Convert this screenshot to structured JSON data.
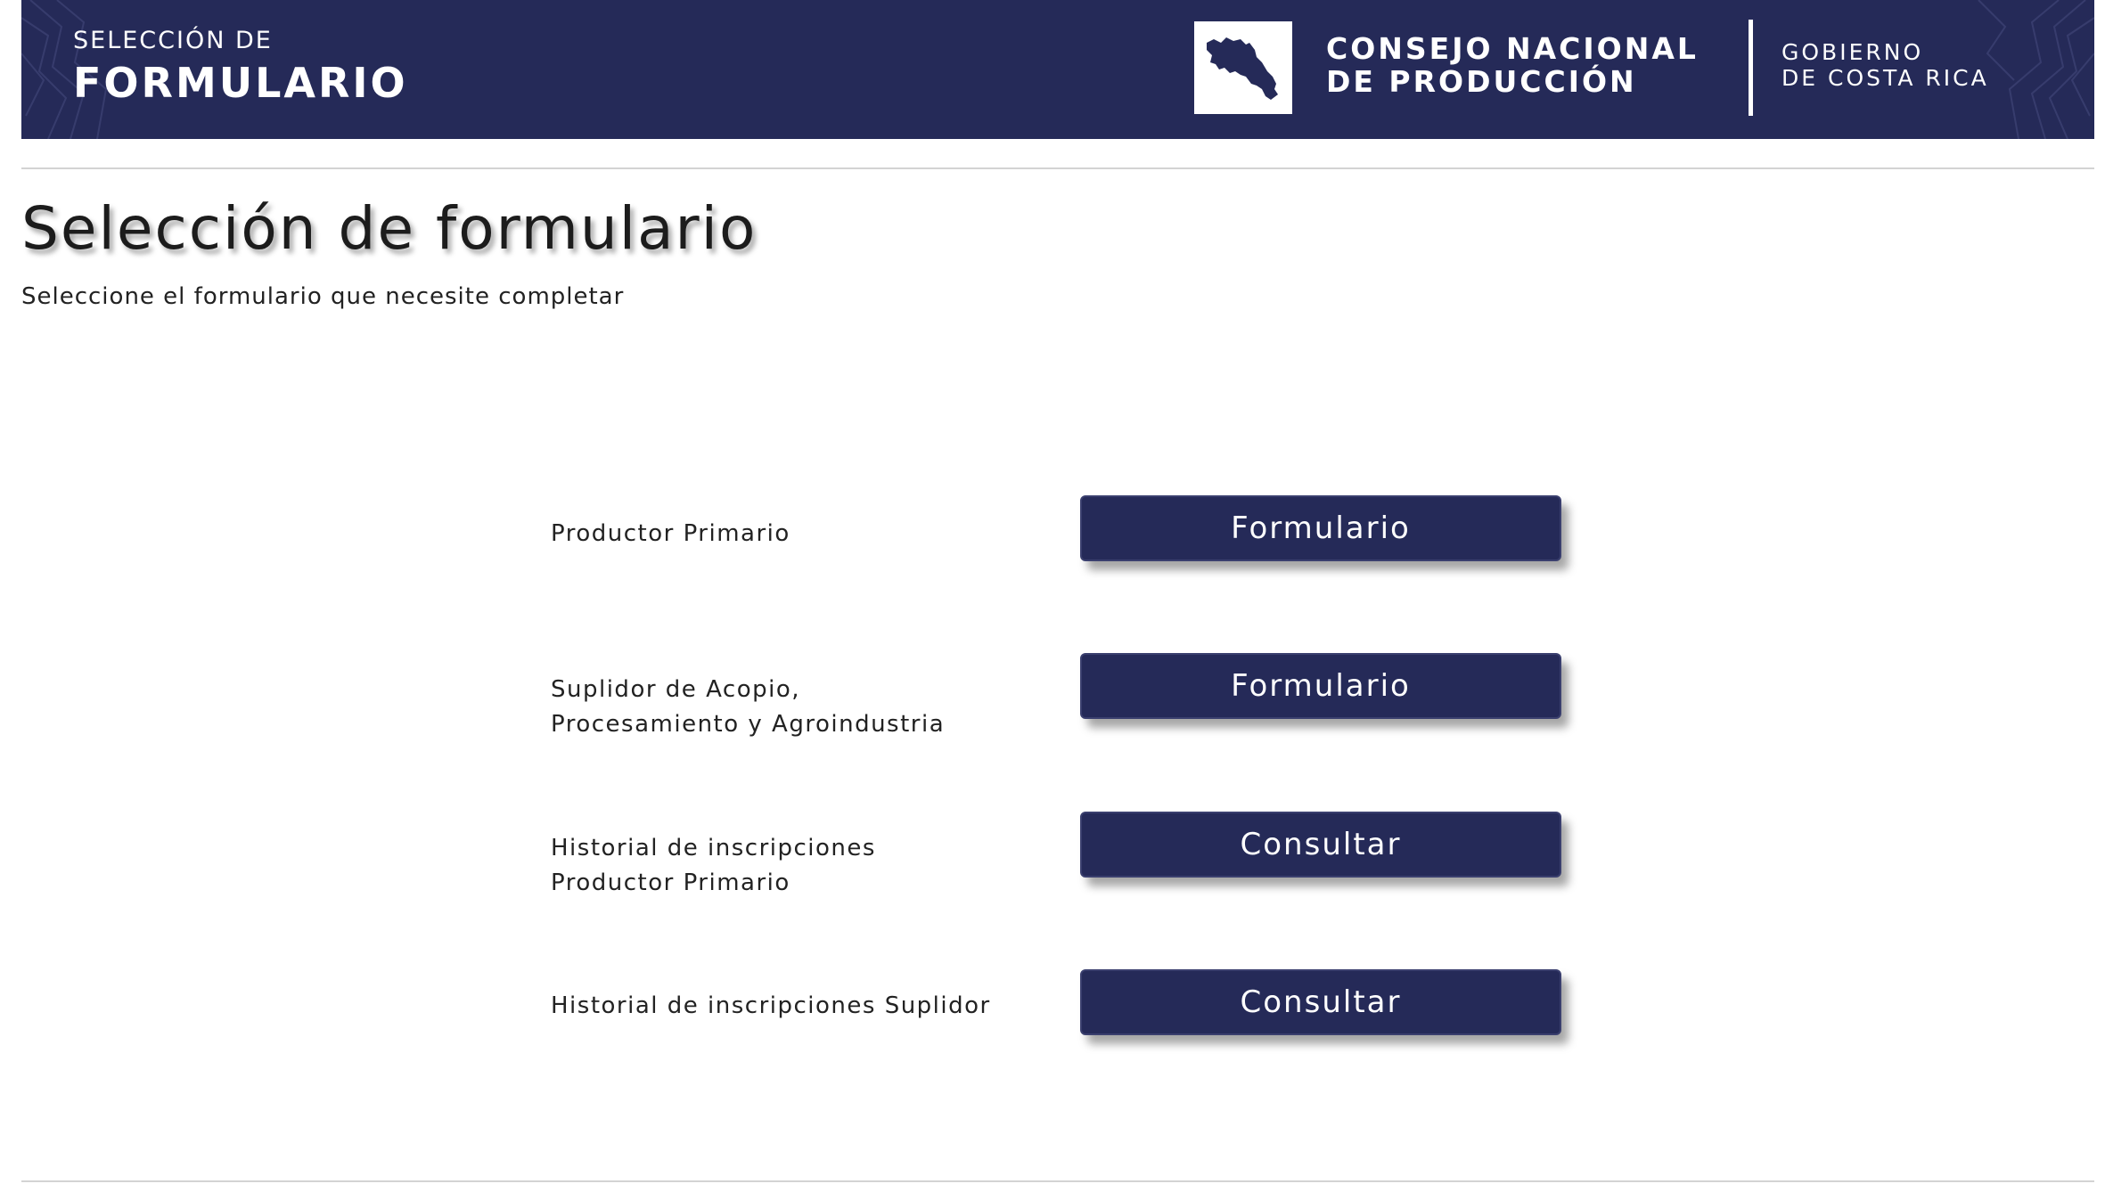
{
  "header": {
    "section_small": "SELECCIÓN DE",
    "section_big": "FORMULARIO",
    "org_line1": "CONSEJO NACIONAL",
    "org_line2": "DE PRODUCCIÓN",
    "gov_line1": "GOBIERNO",
    "gov_line2": "DE COSTA RICA",
    "logo_icon": "costa-rica-map-icon",
    "banner_color": "#252a58"
  },
  "main": {
    "title": "Selección de formulario",
    "subtitle": "Seleccione el formulario que necesite completar"
  },
  "rows": [
    {
      "label_line1": "Productor Primario",
      "label_line2": "",
      "button_label": "Formulario"
    },
    {
      "label_line1": "Suplidor de Acopio,",
      "label_line2": "Procesamiento y Agroindustria",
      "button_label": "Formulario"
    },
    {
      "label_line1": "Historial de inscripciones",
      "label_line2": "Productor Primario",
      "button_label": "Consultar"
    },
    {
      "label_line1": "Historial de inscripciones Suplidor",
      "label_line2": "",
      "button_label": "Consultar"
    }
  ],
  "colors": {
    "primary": "#252a58",
    "text": "#222222",
    "separator": "#d3d3d3"
  }
}
